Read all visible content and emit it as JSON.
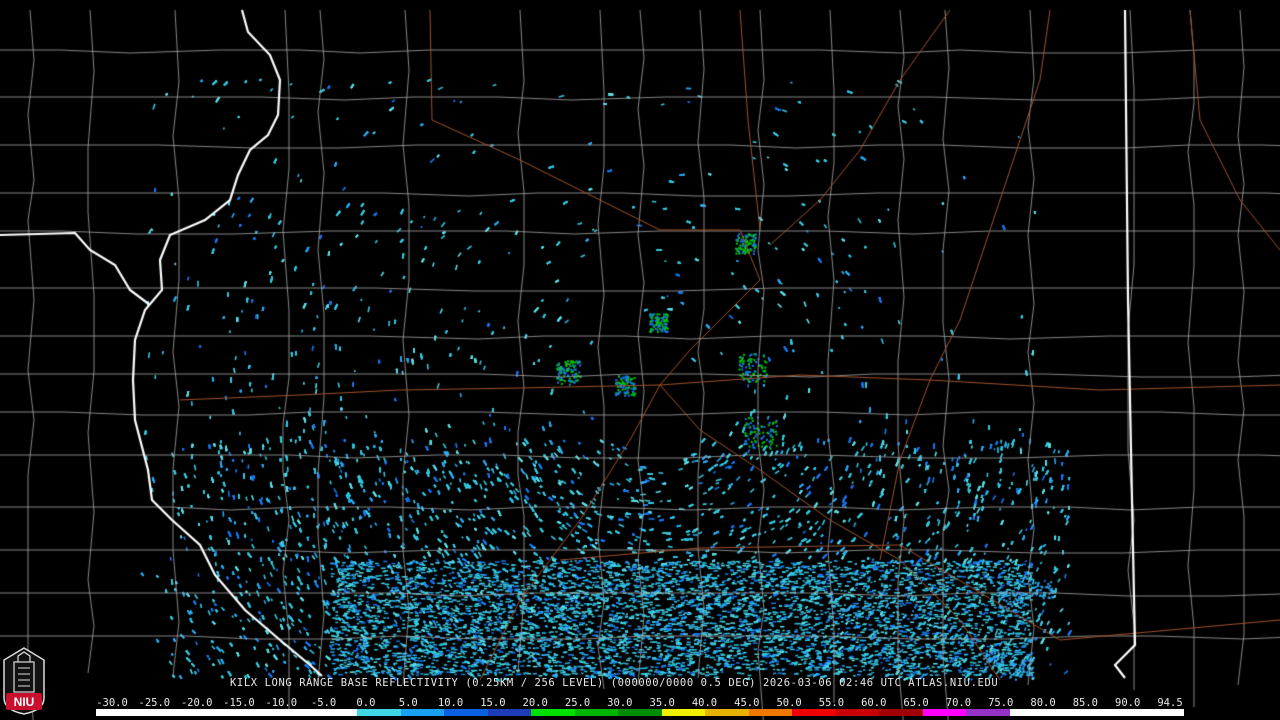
{
  "product_caption": "KILX LONG RANGE BASE REFLECTIVITY (0.25KM / 256 LEVEL) (000000/0000 0.5 DEG) 2026-03-06 02:46 UTC  ATLAS.NIU.EDU",
  "logo": {
    "text": "NIU",
    "color": "#c8102e"
  },
  "legend": {
    "labels": [
      "-30.0",
      "-25.0",
      "-20.0",
      "-15.0",
      "-10.0",
      "-5.0",
      "0.0",
      "5.0",
      "10.0",
      "15.0",
      "20.0",
      "25.0",
      "30.0",
      "35.0",
      "40.0",
      "45.0",
      "50.0",
      "55.0",
      "60.0",
      "65.0",
      "70.0",
      "75.0",
      "80.0",
      "85.0",
      "90.0",
      "94.5"
    ],
    "colors": [
      "#ffffff",
      "#ffffff",
      "#ffffff",
      "#ffffff",
      "#ffffff",
      "#ffffff",
      "#3fd6e6",
      "#1aa0f0",
      "#0a60e0",
      "#1c3cb8",
      "#00e000",
      "#00b400",
      "#008c00",
      "#f0f000",
      "#e6b400",
      "#f07800",
      "#f00000",
      "#c80000",
      "#a00000",
      "#ff00ff",
      "#9632c8",
      "#ffffff",
      "#ffffff",
      "#ffffff",
      "#ffffff"
    ]
  },
  "map_colors": {
    "state_borders": "#ffffff",
    "county_lines": "#a8a8a8",
    "highways": "#a0522d",
    "echo_primary": "#33c8e0",
    "echo_secondary": "#1878f0",
    "echo_strong": "#00c800"
  }
}
